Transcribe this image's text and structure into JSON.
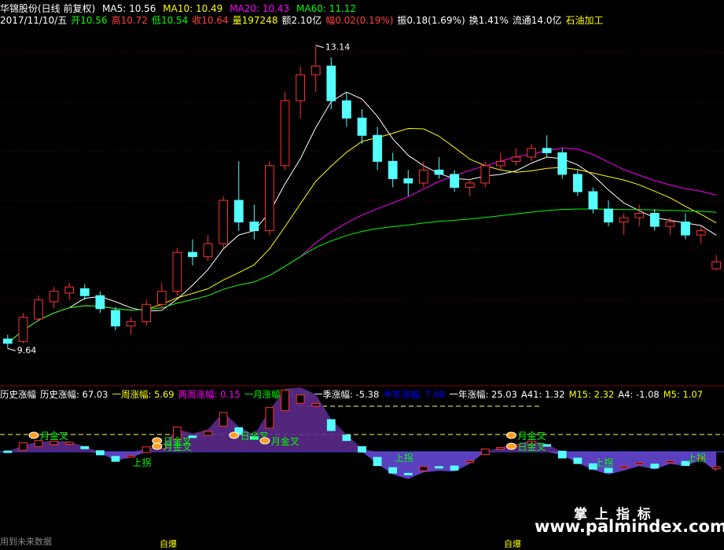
{
  "header": {
    "stock_title": "华锦股份(日线 前复权)",
    "ma_lines": [
      {
        "label": "MA5: 10.56",
        "color": "#ffffff"
      },
      {
        "label": "MA10: 10.49",
        "color": "#ffff00"
      },
      {
        "label": "MA20: 10.43",
        "color": "#ff00ff"
      },
      {
        "label": "MA60: 11.12",
        "color": "#00ff00"
      }
    ],
    "info": [
      {
        "label": "2017/11/10/五",
        "color": "#ffffff"
      },
      {
        "label": "开10.56",
        "color": "#00ff00"
      },
      {
        "label": "高10.72",
        "color": "#ff4040"
      },
      {
        "label": "低10.54",
        "color": "#00ff00"
      },
      {
        "label": "收10.64",
        "color": "#ff4040"
      },
      {
        "label": "量197248",
        "color": "#ffff00"
      },
      {
        "label": "额2.10亿",
        "color": "#ffffff"
      },
      {
        "label": "幅0.02(0.19%)",
        "color": "#ff4040"
      },
      {
        "label": "振0.18(1.69%)",
        "color": "#ffffff"
      },
      {
        "label": "换1.41%",
        "color": "#ffffff"
      },
      {
        "label": "流通14.0亿",
        "color": "#ffffff"
      },
      {
        "label": "石油加工",
        "color": "#ffff00"
      }
    ]
  },
  "indicator": {
    "items": [
      {
        "label": "历史涨幅",
        "color": "#ffffff"
      },
      {
        "label": "历史涨幅: 67.03",
        "color": "#ffffff"
      },
      {
        "label": "一周涨幅: 5.69",
        "color": "#ffff00"
      },
      {
        "label": "两周涨幅: 0.15",
        "color": "#ff00ff"
      },
      {
        "label": "一月涨幅: -1.28",
        "color": "#00ff00"
      },
      {
        "label": "一季涨幅: -5.38",
        "color": "#ffffff"
      },
      {
        "label": "半年涨幅: 7.68",
        "color": "#0000ff"
      },
      {
        "label": "一年涨幅: 25.03",
        "color": "#ffffff"
      },
      {
        "label": "A41: 1.32",
        "color": "#ffffff"
      },
      {
        "label": "M15: 2.32",
        "color": "#ffff00"
      },
      {
        "label": "A4: -1.08",
        "color": "#ffffff"
      },
      {
        "label": "M5: 1.07",
        "color": "#ffff00"
      }
    ],
    "signals": [
      {
        "label": "月金叉",
        "index": 2
      },
      {
        "label": "日金叉",
        "index": 10
      },
      {
        "label": "月金叉",
        "index": 10
      },
      {
        "label": "日金叉",
        "index": 15
      },
      {
        "label": "月金叉",
        "index": 17
      },
      {
        "label": "日金叉",
        "index": 33
      },
      {
        "label": "月金叉",
        "index": 33
      },
      {
        "label": "上拐",
        "index": 8
      },
      {
        "label": "上拐",
        "index": 25
      },
      {
        "label": "上拐",
        "index": 38
      },
      {
        "label": "上拐",
        "index": 44
      }
    ]
  },
  "annotations": {
    "high_label": "13.14",
    "low_label": "9.64",
    "bottom_left": "用到未来数据",
    "bottom_a": "自爆",
    "bottom_b": "自爆",
    "watermark_cn": "掌 上 指 标",
    "watermark_url": "www.palmindex.com"
  },
  "chart_data": {
    "type": "candlestick",
    "price_range": [
      9.4,
      13.3
    ],
    "x_count": 47,
    "candles": [
      [
        9.75,
        9.8,
        9.64,
        9.7
      ],
      [
        9.72,
        10.05,
        9.7,
        10.0
      ],
      [
        9.98,
        10.25,
        9.95,
        10.2
      ],
      [
        10.18,
        10.35,
        10.1,
        10.3
      ],
      [
        10.28,
        10.4,
        10.2,
        10.35
      ],
      [
        10.33,
        10.38,
        10.2,
        10.25
      ],
      [
        10.25,
        10.3,
        10.05,
        10.1
      ],
      [
        10.08,
        10.12,
        9.85,
        9.9
      ],
      [
        9.9,
        10.0,
        9.8,
        9.95
      ],
      [
        9.95,
        10.2,
        9.9,
        10.15
      ],
      [
        10.15,
        10.4,
        10.1,
        10.3
      ],
      [
        10.3,
        10.8,
        10.25,
        10.75
      ],
      [
        10.75,
        10.9,
        10.6,
        10.7
      ],
      [
        10.7,
        10.95,
        10.65,
        10.85
      ],
      [
        10.85,
        11.4,
        10.8,
        11.35
      ],
      [
        11.35,
        11.8,
        11.0,
        11.1
      ],
      [
        11.1,
        11.3,
        10.9,
        11.0
      ],
      [
        11.0,
        11.8,
        10.95,
        11.75
      ],
      [
        11.75,
        12.6,
        11.7,
        12.5
      ],
      [
        12.5,
        12.9,
        12.3,
        12.8
      ],
      [
        12.8,
        13.14,
        12.6,
        12.9
      ],
      [
        12.9,
        13.0,
        12.4,
        12.5
      ],
      [
        12.5,
        12.6,
        12.2,
        12.3
      ],
      [
        12.3,
        12.4,
        12.0,
        12.1
      ],
      [
        12.1,
        12.2,
        11.7,
        11.8
      ],
      [
        11.8,
        11.9,
        11.5,
        11.6
      ],
      [
        11.6,
        11.7,
        11.4,
        11.55
      ],
      [
        11.55,
        11.8,
        11.5,
        11.7
      ],
      [
        11.7,
        11.85,
        11.6,
        11.65
      ],
      [
        11.65,
        11.7,
        11.45,
        11.5
      ],
      [
        11.5,
        11.6,
        11.4,
        11.55
      ],
      [
        11.55,
        11.8,
        11.5,
        11.75
      ],
      [
        11.75,
        11.9,
        11.7,
        11.8
      ],
      [
        11.8,
        11.95,
        11.75,
        11.85
      ],
      [
        11.85,
        12.0,
        11.8,
        11.95
      ],
      [
        11.95,
        12.1,
        11.85,
        11.9
      ],
      [
        11.9,
        11.95,
        11.6,
        11.65
      ],
      [
        11.65,
        11.7,
        11.4,
        11.45
      ],
      [
        11.45,
        11.5,
        11.2,
        11.25
      ],
      [
        11.25,
        11.35,
        11.05,
        11.1
      ],
      [
        11.1,
        11.2,
        10.95,
        11.15
      ],
      [
        11.15,
        11.3,
        11.05,
        11.2
      ],
      [
        11.2,
        11.25,
        11.0,
        11.05
      ],
      [
        11.05,
        11.15,
        10.95,
        11.1
      ],
      [
        11.1,
        11.2,
        10.9,
        10.95
      ],
      [
        10.95,
        11.05,
        10.85,
        11.0
      ],
      [
        10.56,
        10.72,
        10.54,
        10.64
      ]
    ],
    "series": [
      {
        "name": "MA5",
        "color": "#ffffff"
      },
      {
        "name": "MA10",
        "color": "#ffff00"
      },
      {
        "name": "MA20",
        "color": "#ff00ff"
      },
      {
        "name": "MA60",
        "color": "#00ff00"
      }
    ]
  }
}
